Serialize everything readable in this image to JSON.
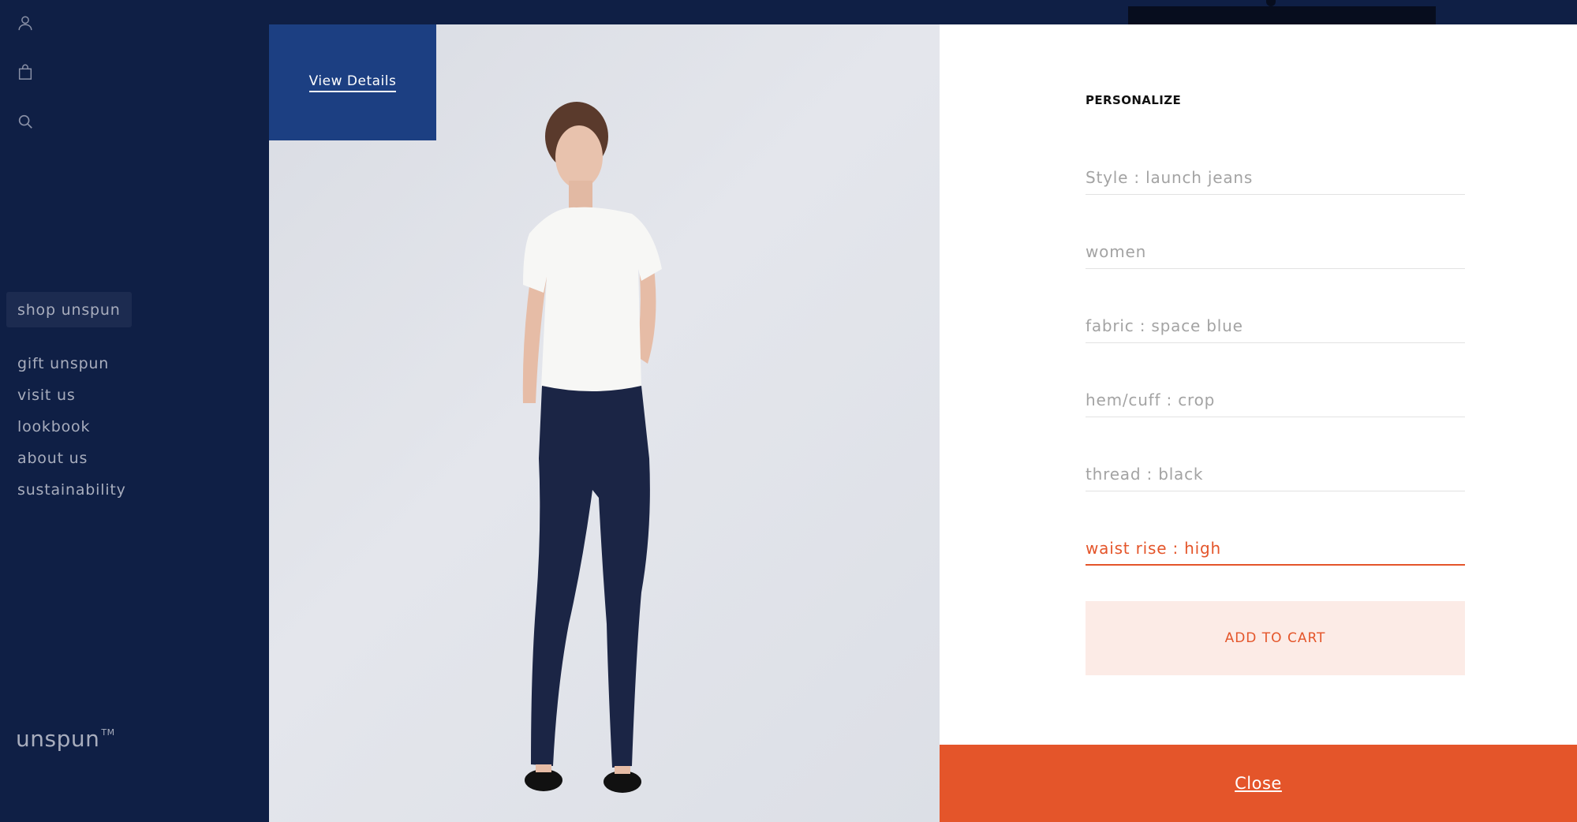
{
  "sidebar": {
    "icons": [
      "user-icon",
      "shopping-bag-icon",
      "search-icon"
    ],
    "shop_label": "shop unspun",
    "items": [
      {
        "label": "gift unspun"
      },
      {
        "label": "visit us"
      },
      {
        "label": "lookbook"
      },
      {
        "label": "about us"
      },
      {
        "label": "sustainability"
      }
    ],
    "brand": "unspun",
    "brand_mark": "TM"
  },
  "modal": {
    "view_details_label": "View Details",
    "form": {
      "title": "PERSONALIZE",
      "fields": [
        {
          "label": "Style : launch jeans"
        },
        {
          "label": "women"
        },
        {
          "label": "fabric : space blue"
        },
        {
          "label": "hem/cuff : crop"
        },
        {
          "label": "thread : black"
        },
        {
          "label": "waist rise : high"
        }
      ],
      "add_to_cart_label": "ADD TO CART"
    },
    "close_label": "Close"
  },
  "colors": {
    "sidebar_bg": "#0f1f45",
    "view_details_bg": "#1c3f82",
    "accent": "#e4552a",
    "cart_bg": "#fcebe6"
  }
}
